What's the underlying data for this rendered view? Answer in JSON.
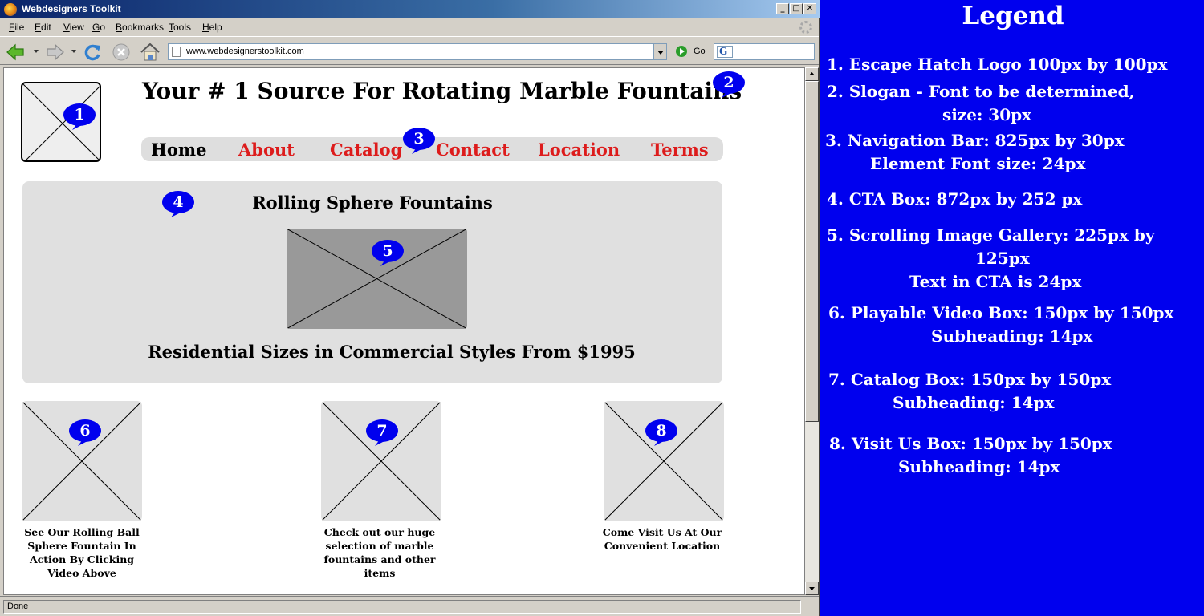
{
  "window": {
    "title": "Webdesigners Toolkit",
    "minimize": "_",
    "maximize": "□",
    "close": "✕"
  },
  "menu": [
    "File",
    "Edit",
    "View",
    "Go",
    "Bookmarks",
    "Tools",
    "Help"
  ],
  "toolbar": {
    "url": "www.webdesignerstoolkit.com",
    "go_label": "Go",
    "search_engine_letter": "G",
    "icons": [
      "back-icon",
      "forward-icon",
      "reload-icon",
      "stop-icon",
      "home-icon"
    ]
  },
  "status": "Done",
  "page": {
    "slogan": "Your # 1 Source For Rotating Marble Fountains",
    "nav": [
      "Home",
      "About",
      "Catalog",
      "Contact",
      "Location",
      "Terms"
    ],
    "active_nav": "Home",
    "cta_title": "Rolling Sphere Fountains",
    "cta_price": "Residential Sizes in Commercial Styles From $1995",
    "features": [
      {
        "caption": "See Our Rolling Ball Sphere Fountain In Action By Clicking Video Above"
      },
      {
        "caption": "Check out our huge selection of marble fountains and other items"
      },
      {
        "caption": "Come Visit Us At Our Convenient Location"
      }
    ],
    "markers": [
      "1",
      "2",
      "3",
      "4",
      "5",
      "6",
      "7",
      "8"
    ]
  },
  "legend": {
    "title": "Legend",
    "lines": [
      "1.  Escape Hatch Logo 100px by 100px",
      "2. Slogan - Font to be determined,",
      "size: 30px",
      "3. Navigation Bar: 825px by 30px",
      "Element Font size: 24px",
      "4. CTA Box: 872px by 252 px",
      "5. Scrolling Image Gallery: 225px by",
      "125px",
      "Text in CTA is 24px",
      "6. Playable Video Box: 150px by 150px",
      "Subheading: 14px",
      "7. Catalog Box: 150px by 150px",
      "Subheading: 14px",
      "8. Visit Us Box: 150px by 150px",
      "Subheading: 14px"
    ]
  },
  "colors": {
    "legend_bg": "#0000ee",
    "marker": "#0000ee",
    "nav_link": "#dd1c1c",
    "placeholder": "#e0e0e0"
  }
}
